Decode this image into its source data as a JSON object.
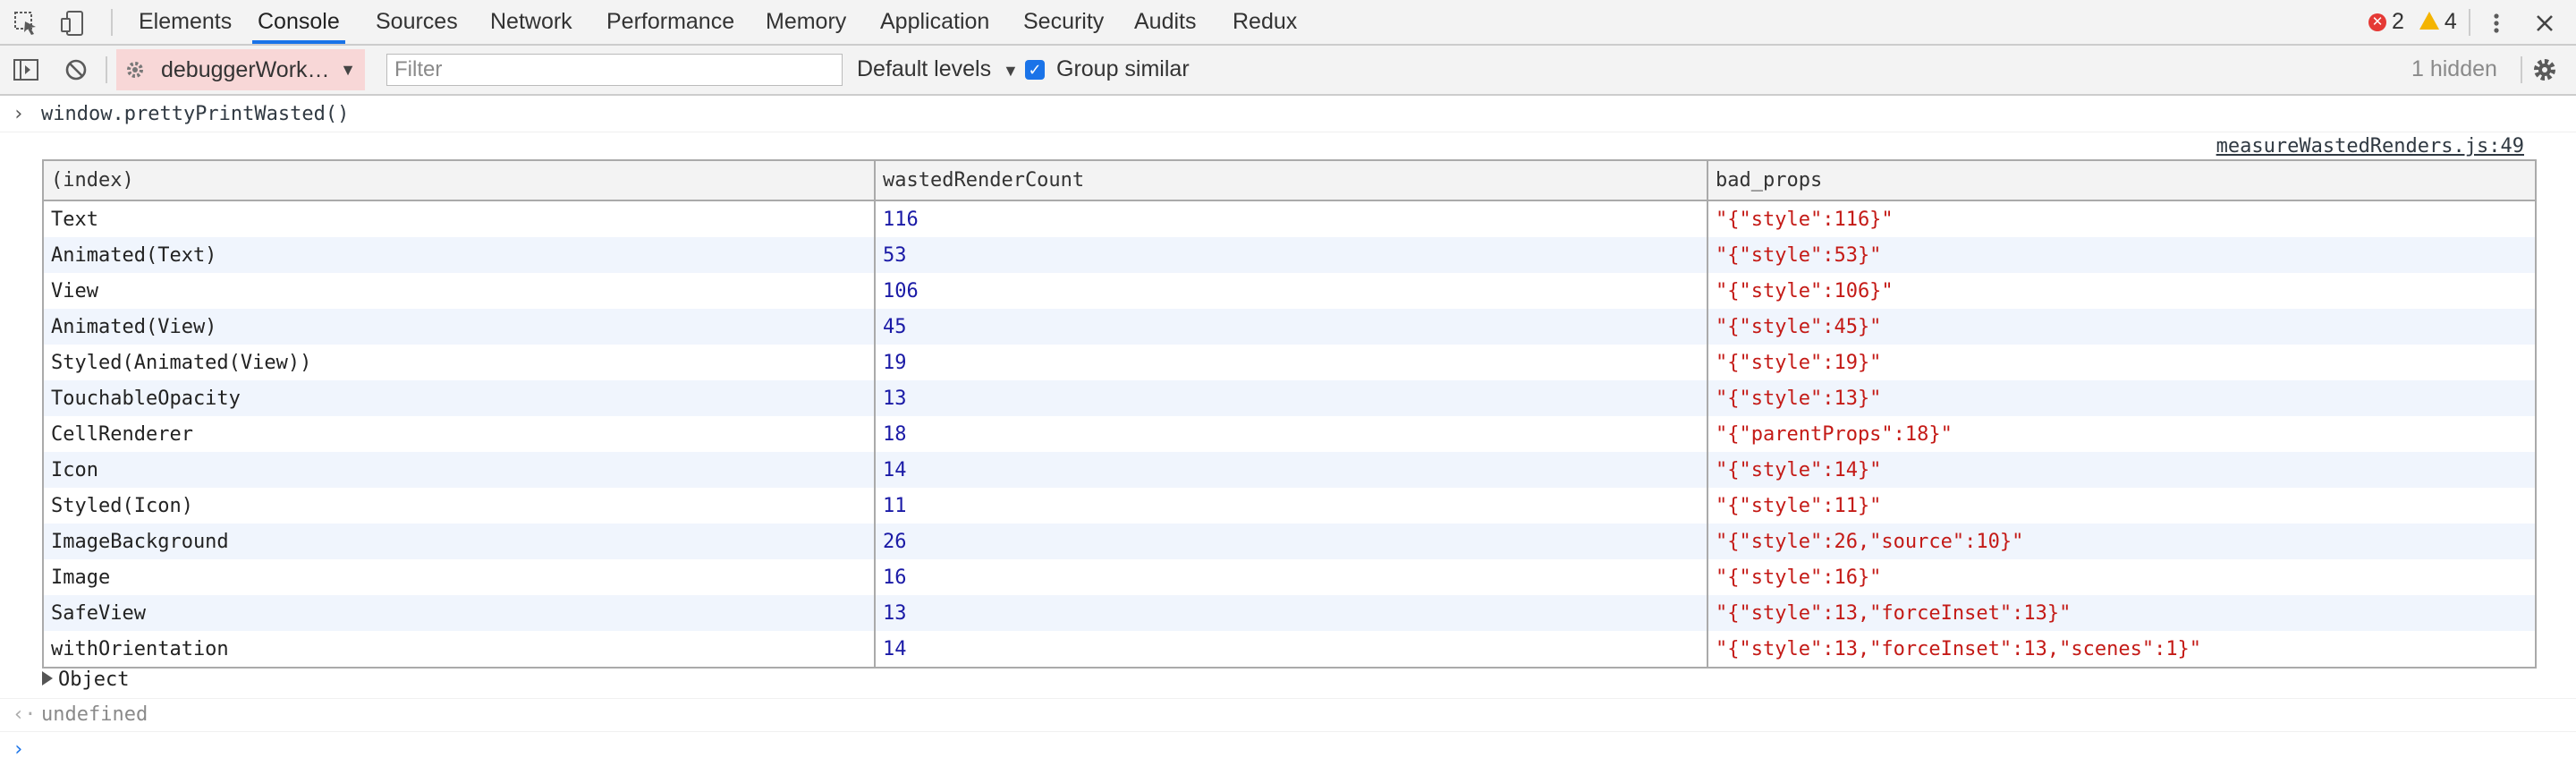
{
  "tabs": [
    "Elements",
    "Console",
    "Sources",
    "Network",
    "Performance",
    "Memory",
    "Application",
    "Security",
    "Audits",
    "Redux"
  ],
  "active_tab": "Console",
  "status": {
    "errors": "2",
    "warnings": "4"
  },
  "toolbar": {
    "context": "debuggerWork…",
    "filter_placeholder": "Filter",
    "levels": "Default levels",
    "group_similar": "Group similar",
    "hidden": "1 hidden"
  },
  "console": {
    "command": "window.prettyPrintWasted()",
    "source_link": "measureWastedRenders.js:49",
    "table": {
      "headers": [
        "(index)",
        "wastedRenderCount",
        "bad_props"
      ],
      "rows": [
        [
          "Text",
          "116",
          "\"{\"style\":116}\""
        ],
        [
          "Animated(Text)",
          "53",
          "\"{\"style\":53}\""
        ],
        [
          "View",
          "106",
          "\"{\"style\":106}\""
        ],
        [
          "Animated(View)",
          "45",
          "\"{\"style\":45}\""
        ],
        [
          "Styled(Animated(View))",
          "19",
          "\"{\"style\":19}\""
        ],
        [
          "TouchableOpacity",
          "13",
          "\"{\"style\":13}\""
        ],
        [
          "CellRenderer",
          "18",
          "\"{\"parentProps\":18}\""
        ],
        [
          "Icon",
          "14",
          "\"{\"style\":14}\""
        ],
        [
          "Styled(Icon)",
          "11",
          "\"{\"style\":11}\""
        ],
        [
          "ImageBackground",
          "26",
          "\"{\"style\":26,\"source\":10}\""
        ],
        [
          "Image",
          "16",
          "\"{\"style\":16}\""
        ],
        [
          "SafeView",
          "13",
          "\"{\"style\":13,\"forceInset\":13}\""
        ],
        [
          "withOrientation",
          "14",
          "\"{\"style\":13,\"forceInset\":13,\"scenes\":1}\""
        ]
      ]
    },
    "object_label": "Object",
    "result": "undefined"
  },
  "colors": {
    "accent": "#1a73e8",
    "number": "#1a1aa6",
    "string": "#c41a16",
    "error": "#e53935",
    "warning": "#f4b400"
  }
}
